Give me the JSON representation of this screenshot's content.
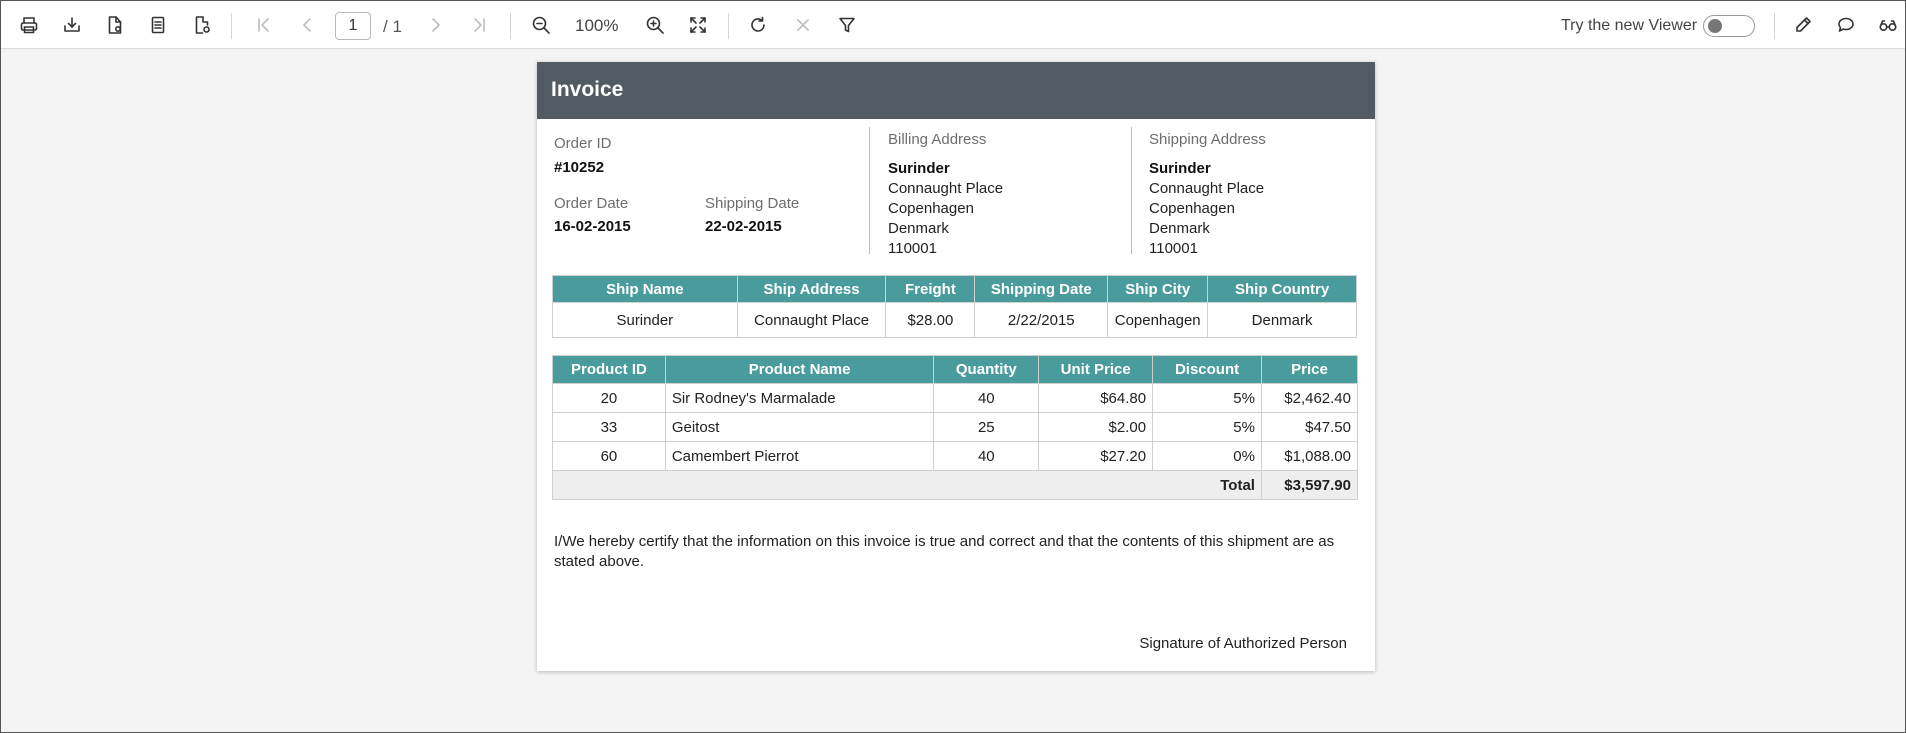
{
  "toolbar": {
    "page_current": "1",
    "page_total": "/ 1",
    "zoom": "100%",
    "try_viewer_label": "Try the new Viewer",
    "icons": [
      "print-icon",
      "export-icon",
      "export-setup-icon",
      "page-icon",
      "page-setup-icon",
      "first-page-icon",
      "previous-page-icon",
      "next-page-icon",
      "last-page-icon",
      "zoom-out-icon",
      "zoom-in-icon",
      "fit-page-icon",
      "refresh-icon",
      "stop-icon",
      "filter-icon",
      "annotate-icon",
      "comment-icon",
      "glasses-icon"
    ]
  },
  "invoice": {
    "title": "Invoice",
    "order_id_label": "Order ID",
    "order_id": "#10252",
    "order_date_label": "Order Date",
    "order_date": "16-02-2015",
    "shipping_date_label": "Shipping Date",
    "shipping_date": "22-02-2015",
    "billing": {
      "label": "Billing Address",
      "name": "Surinder",
      "line1": "Connaught Place",
      "line2": "Copenhagen",
      "line3": "Denmark",
      "line4": "110001"
    },
    "shipping": {
      "label": "Shipping Address",
      "name": "Surinder",
      "line1": "Connaught Place",
      "line2": "Copenhagen",
      "line3": "Denmark",
      "line4": "110001"
    },
    "ship_table": {
      "headers": [
        "Ship Name",
        "Ship Address",
        "Freight",
        "Shipping Date",
        "Ship City",
        "Ship Country"
      ],
      "row": [
        "Surinder",
        "Connaught Place",
        "$28.00",
        "2/22/2015",
        "Copenhagen",
        "Denmark"
      ]
    },
    "products": {
      "headers": [
        "Product ID",
        "Product Name",
        "Quantity",
        "Unit Price",
        "Discount",
        "Price"
      ],
      "rows": [
        [
          "20",
          "Sir Rodney's Marmalade",
          "40",
          "$64.80",
          "5%",
          "$2,462.40"
        ],
        [
          "33",
          "Geitost",
          "25",
          "$2.00",
          "5%",
          "$47.50"
        ],
        [
          "60",
          "Camembert Pierrot",
          "40",
          "$27.20",
          "0%",
          "$1,088.00"
        ]
      ],
      "total_label": "Total",
      "total_value": "$3,597.90"
    },
    "certification": "I/We hereby certify that the information on this invoice is true and correct and that the contents of this shipment are as stated above.",
    "signature_label": "Signature of Authorized Person"
  },
  "colors": {
    "header_bg": "#525a63",
    "table_header_bg": "#4a9c9c",
    "page_bg": "#f4f4f4"
  }
}
